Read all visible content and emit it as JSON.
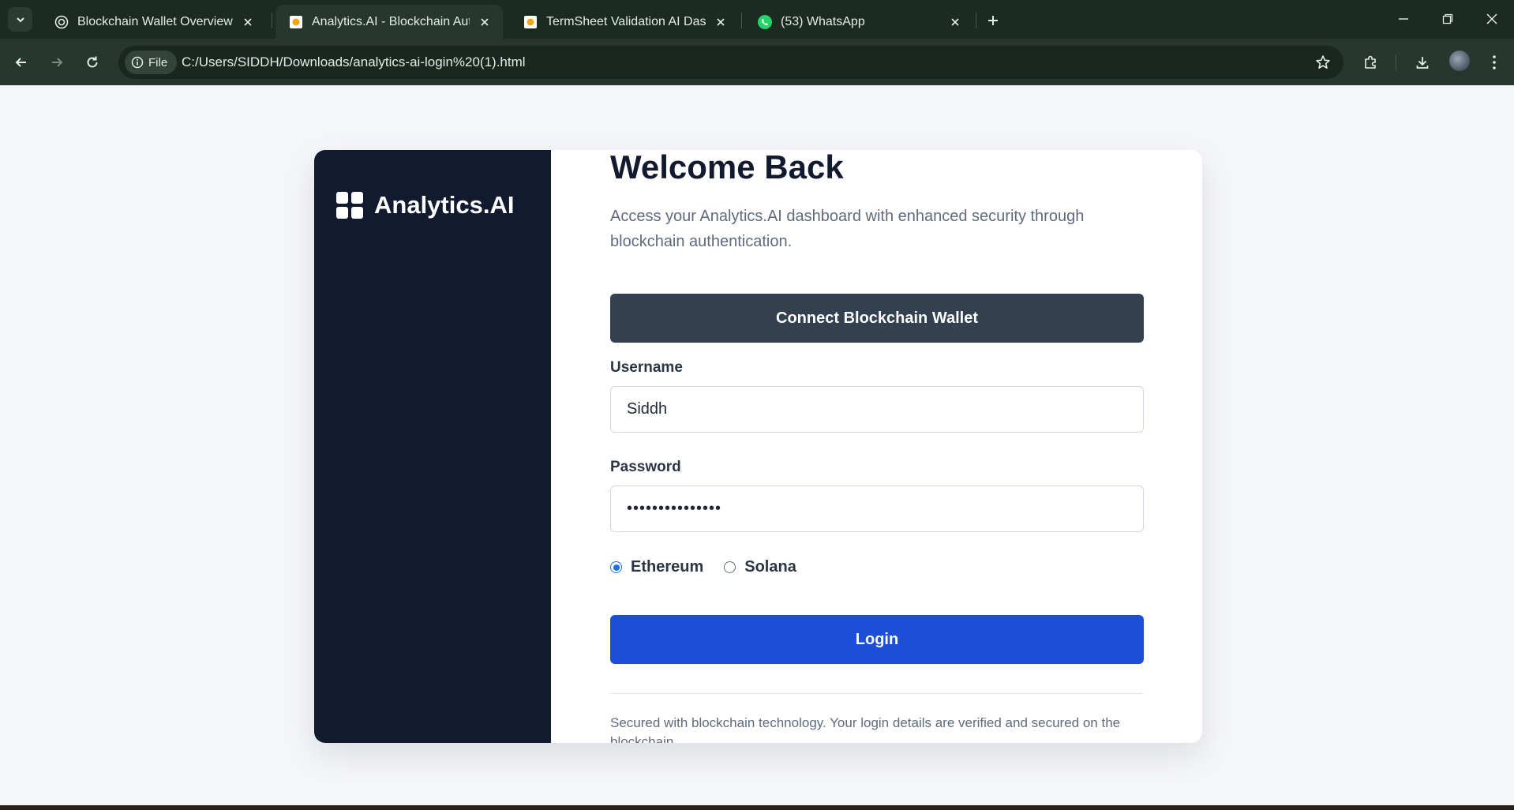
{
  "browser": {
    "tabs": [
      {
        "title": "Blockchain Wallet Overview",
        "favicon": "openai-icon"
      },
      {
        "title": "Analytics.AI - Blockchain Authentication",
        "favicon": "local-file-icon"
      },
      {
        "title": "TermSheet Validation AI Dashboard",
        "favicon": "local-file-icon"
      },
      {
        "title": "(53) WhatsApp",
        "favicon": "whatsapp-icon"
      }
    ],
    "address": {
      "chip_label": "File",
      "url": "C:/Users/SIDDH/Downloads/analytics-ai-login%20(1).html"
    }
  },
  "sidebar": {
    "brand": "Analytics.AI"
  },
  "login": {
    "heading": "Welcome Back",
    "subtitle": "Access your Analytics.AI dashboard with enhanced security through blockchain authentication.",
    "connect_wallet_label": "Connect Blockchain Wallet",
    "username_label": "Username",
    "username_value": "Siddh",
    "password_label": "Password",
    "password_value": "•••••••••••••••",
    "networks": [
      {
        "label": "Ethereum",
        "selected": true
      },
      {
        "label": "Solana",
        "selected": false
      }
    ],
    "login_label": "Login",
    "footer_text": "Secured with blockchain technology. Your login details are verified and secured on the blockchain."
  },
  "colors": {
    "sidebar_bg": "#111a2e",
    "wallet_button": "#33404f",
    "login_button": "#1d4ed8",
    "radio_selected": "#1a73e8"
  }
}
